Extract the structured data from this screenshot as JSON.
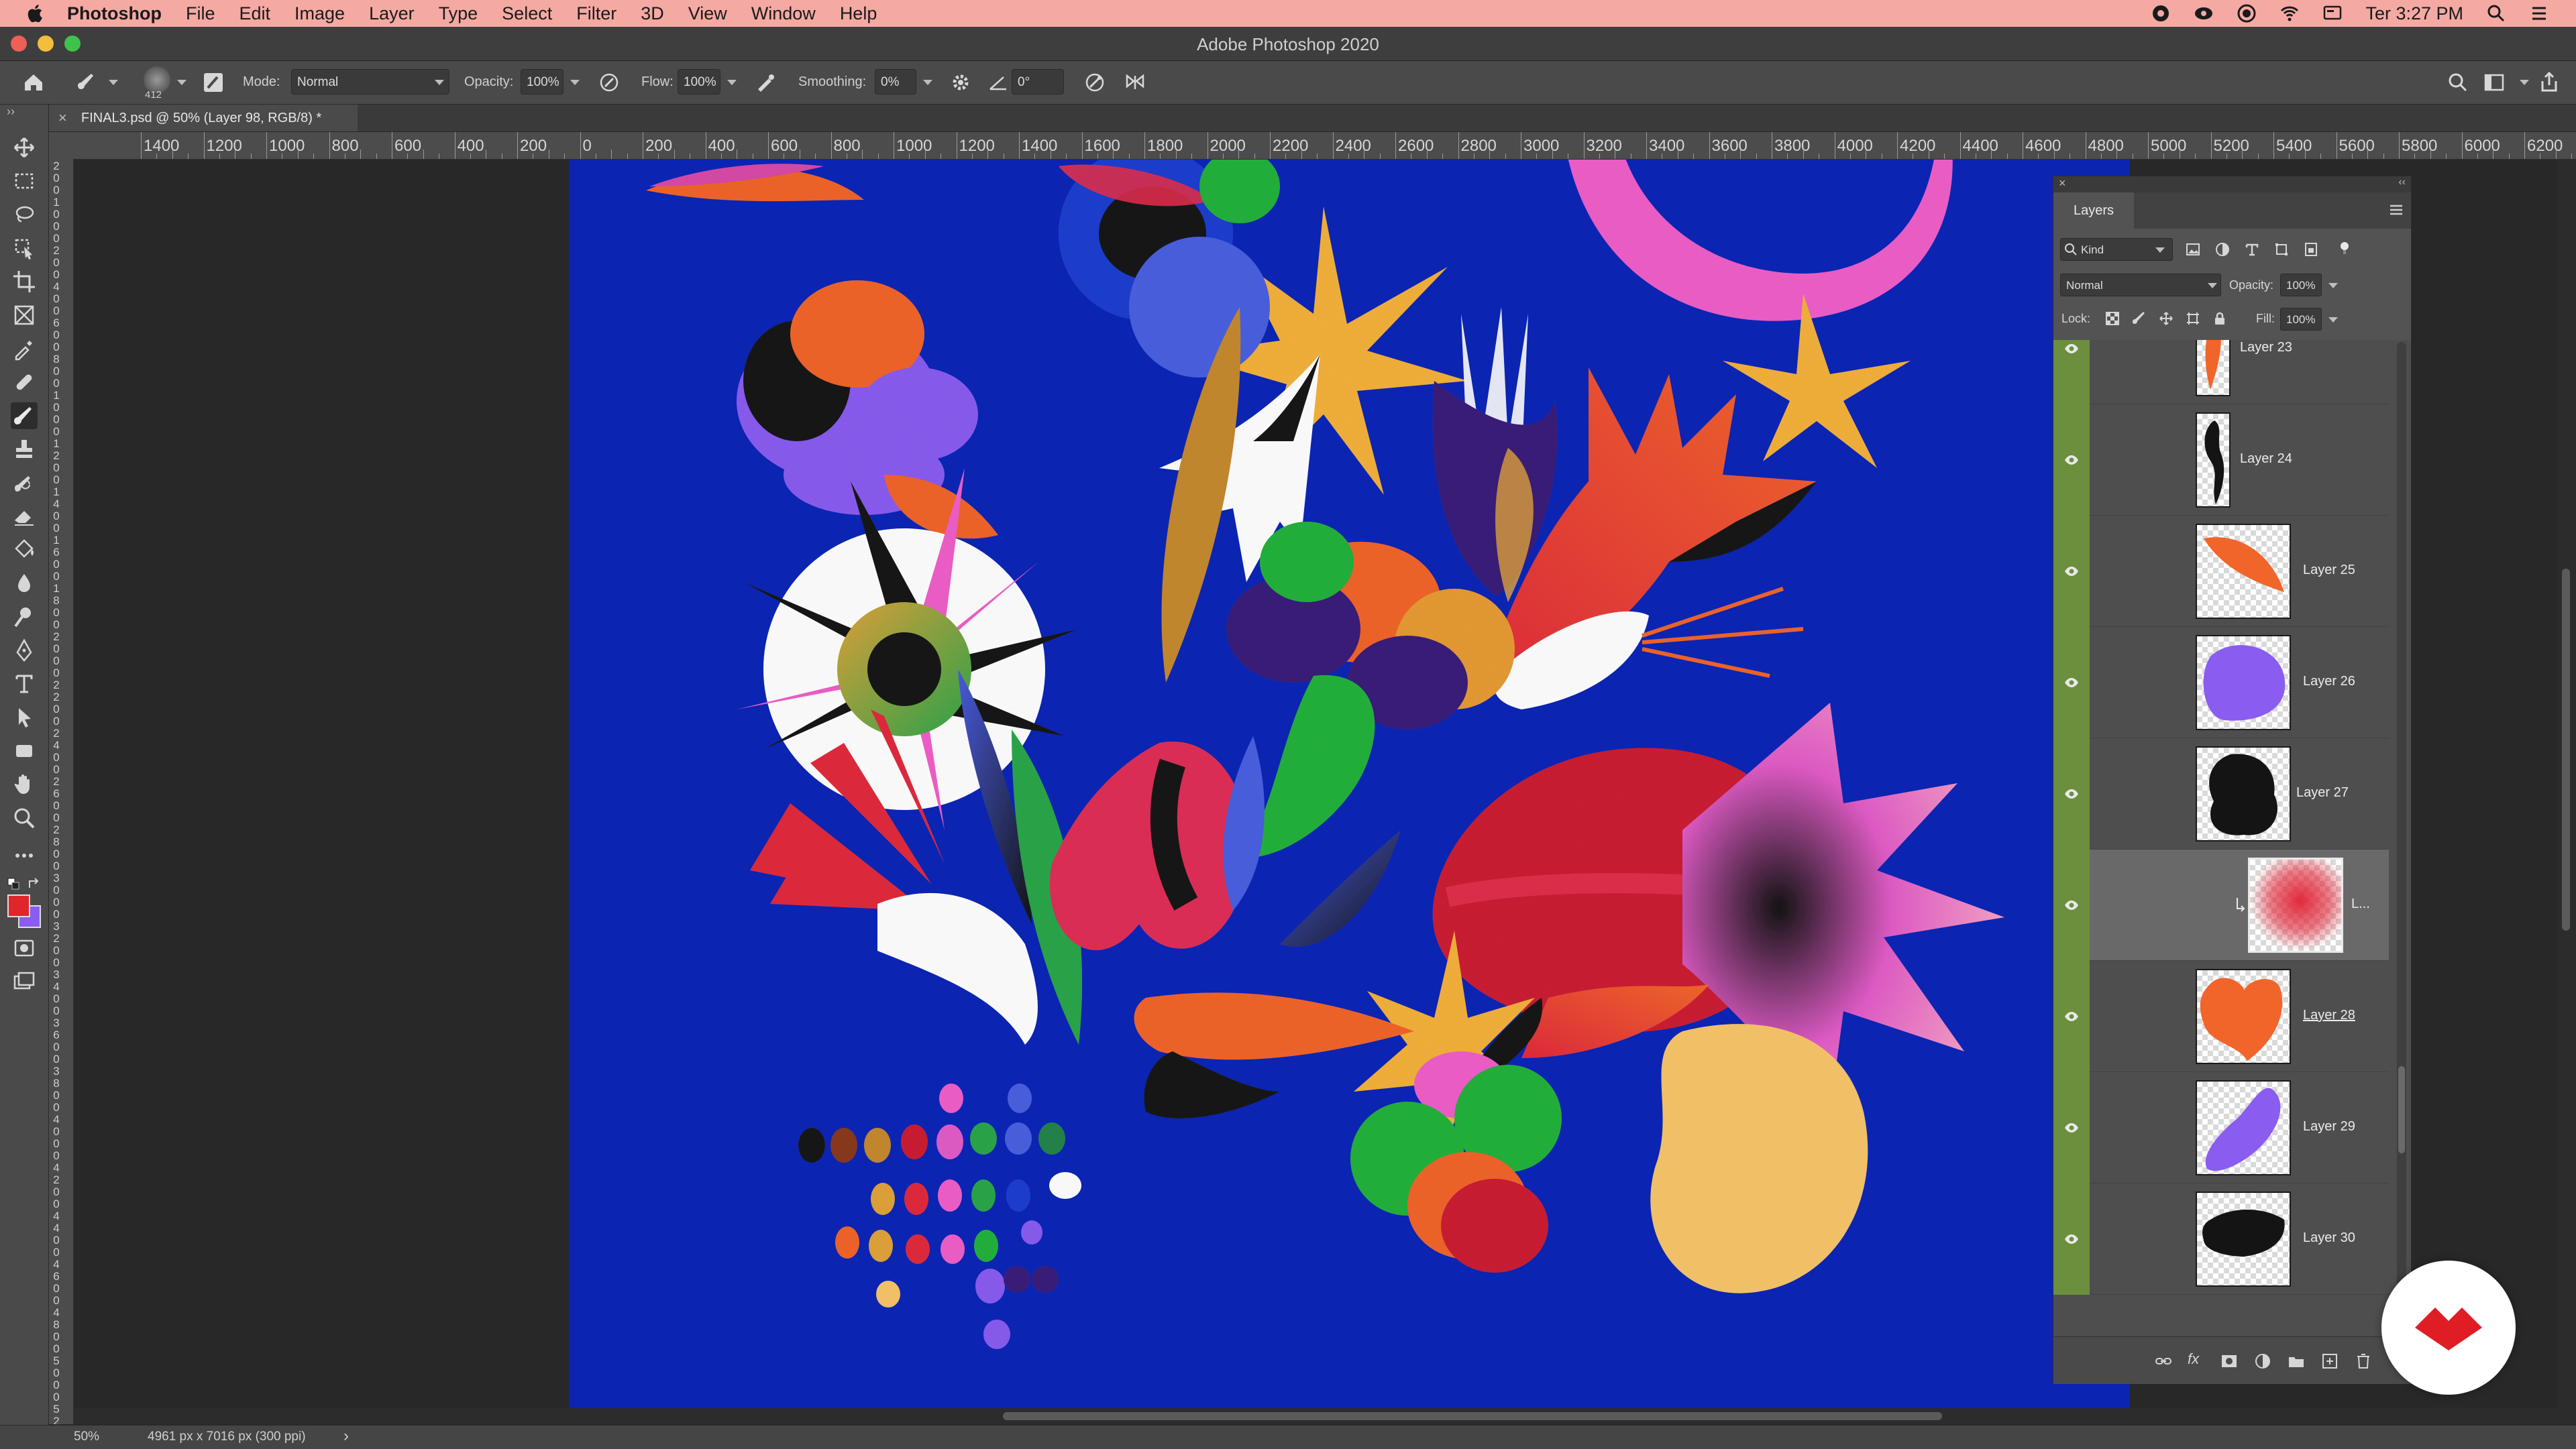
{
  "menubar": {
    "app_name": "Photoshop",
    "items": [
      "File",
      "Edit",
      "Image",
      "Layer",
      "Type",
      "Select",
      "Filter",
      "3D",
      "View",
      "Window",
      "Help"
    ],
    "clock": "Ter 3:27 PM"
  },
  "window": {
    "title": "Adobe Photoshop 2020"
  },
  "options_bar": {
    "brush_size": "412",
    "mode_label": "Mode:",
    "mode_value": "Normal",
    "opacity_label": "Opacity:",
    "opacity_value": "100%",
    "flow_label": "Flow:",
    "flow_value": "100%",
    "smoothing_label": "Smoothing:",
    "smoothing_value": "0%",
    "angle_value": "0°"
  },
  "document": {
    "tab_title": "FINAL3.psd @ 50% (Layer 98, RGB/8) *",
    "close_glyph": "×"
  },
  "ruler": {
    "h_labels": [
      "1400",
      "1200",
      "1000",
      "800",
      "600",
      "400",
      "200",
      "0",
      "200",
      "400",
      "600",
      "800",
      "1000",
      "1200",
      "1400",
      "1600",
      "1800",
      "2000",
      "2200",
      "2400",
      "2600",
      "2800",
      "3000",
      "3200",
      "3400",
      "3600",
      "3800",
      "4000",
      "4200",
      "4400",
      "4600",
      "4800",
      "5000",
      "5200",
      "5400",
      "5600",
      "5800",
      "6000",
      "6200"
    ],
    "v_labels": [
      "2",
      "0",
      "0",
      "1",
      "0",
      "0",
      "0",
      "2",
      "0",
      "0",
      "4",
      "0",
      "0",
      "6",
      "0",
      "0",
      "8",
      "0",
      "0",
      "1",
      "0",
      "0",
      "0",
      "1",
      "2",
      "0",
      "0",
      "1",
      "4",
      "0",
      "0",
      "1",
      "6",
      "0",
      "0",
      "1",
      "8",
      "0",
      "0",
      "2",
      "0",
      "0",
      "0",
      "2",
      "2",
      "0",
      "0",
      "2",
      "4",
      "0",
      "0",
      "2",
      "6",
      "0",
      "0",
      "2",
      "8",
      "0",
      "0",
      "3",
      "0",
      "0",
      "0",
      "3",
      "2",
      "0",
      "0",
      "3",
      "4",
      "0",
      "0",
      "3",
      "6",
      "0",
      "0",
      "3",
      "8",
      "0",
      "0",
      "4",
      "0",
      "0",
      "0",
      "4",
      "2",
      "0",
      "0",
      "4",
      "4",
      "0",
      "0",
      "4",
      "6",
      "0",
      "0",
      "4",
      "8",
      "0",
      "0",
      "5",
      "0",
      "0",
      "0",
      "5",
      "2",
      "0",
      "0"
    ]
  },
  "status_bar": {
    "zoom": "50%",
    "doc_info": "4961 px x 7016 px (300 ppi)",
    "arrow": "›"
  },
  "layers_panel": {
    "tab_label": "Layers",
    "filter_kind": "Kind",
    "blend_mode": "Normal",
    "opacity_label": "Opacity:",
    "opacity_value": "100%",
    "lock_label": "Lock:",
    "fill_label": "Fill:",
    "fill_value": "100%",
    "layers": [
      {
        "name": "Layer 23",
        "selected": false,
        "clipped": false,
        "thumb": "orange-drop"
      },
      {
        "name": "Layer 24",
        "selected": false,
        "clipped": false,
        "thumb": "black-drop"
      },
      {
        "name": "Layer 25",
        "selected": false,
        "clipped": false,
        "thumb": "orange-leaf"
      },
      {
        "name": "Layer 26",
        "selected": false,
        "clipped": false,
        "thumb": "purple-blob"
      },
      {
        "name": "Layer 27",
        "selected": false,
        "clipped": false,
        "thumb": "black-blob"
      },
      {
        "name": "L...",
        "selected": true,
        "clipped": true,
        "thumb": "red-spray"
      },
      {
        "name": "Layer 28",
        "selected": false,
        "clipped": false,
        "thumb": "orange-heart",
        "underline": true
      },
      {
        "name": "Layer 29",
        "selected": false,
        "clipped": false,
        "thumb": "purple-stroke"
      },
      {
        "name": "Layer 30",
        "selected": false,
        "clipped": false,
        "thumb": "black-stroke"
      }
    ]
  },
  "colors": {
    "menubar_bg": "#f5a9a3",
    "canvas_blue": "#0b24b2",
    "foreground": "#e0262b",
    "background": "#8a5cf0",
    "visibility_green": "#6c8f3e"
  }
}
